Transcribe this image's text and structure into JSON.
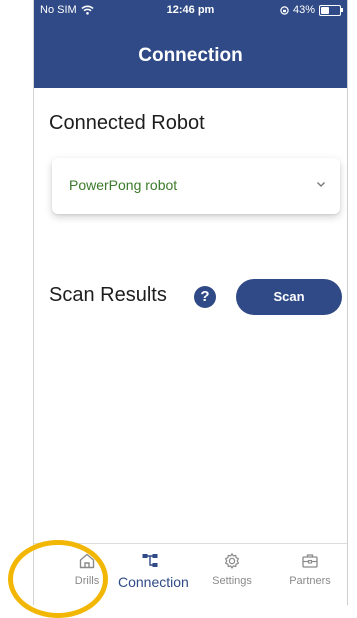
{
  "status_bar": {
    "carrier": "No SIM",
    "time": "12:46 pm",
    "battery": "43%"
  },
  "header": {
    "title": "Connection"
  },
  "connected_robot": {
    "title": "Connected Robot",
    "selected_robot": "PowerPong robot"
  },
  "scan_results": {
    "title": "Scan Results",
    "help_icon": "?",
    "scan_button_label": "Scan"
  },
  "tabs": [
    {
      "label": "Drills",
      "icon": "home-icon",
      "active": false
    },
    {
      "label": "Connection",
      "icon": "network-icon",
      "active": true
    },
    {
      "label": "Settings",
      "icon": "gear-icon",
      "active": false
    },
    {
      "label": "Partners",
      "icon": "briefcase-icon",
      "active": false
    }
  ],
  "colors": {
    "primary": "#2f4a86",
    "robot_text": "#3b7a2a",
    "tab_inactive": "#8a8a8a",
    "highlight": "#f2b705"
  }
}
